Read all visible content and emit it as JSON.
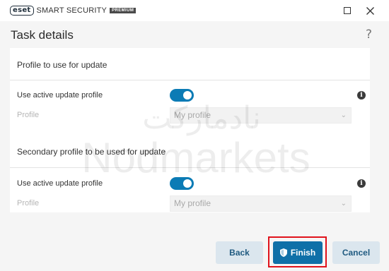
{
  "app": {
    "brand": "eset",
    "product": "SMART SECURITY",
    "edition": "PREMIUM"
  },
  "header": {
    "title": "Task details",
    "help": "?"
  },
  "sections": [
    {
      "title": "Profile to use for update",
      "toggle_label": "Use active update profile",
      "toggle_on": true,
      "profile_label": "Profile",
      "profile_value": "My profile"
    },
    {
      "title": "Secondary profile to be used for update",
      "toggle_label": "Use active update profile",
      "toggle_on": true,
      "profile_label": "Profile",
      "profile_value": "My profile"
    }
  ],
  "watermark": {
    "arabic": "نادمارکت",
    "latin": "Nodmarkets"
  },
  "buttons": {
    "back": "Back",
    "finish": "Finish",
    "cancel": "Cancel"
  },
  "colors": {
    "accent": "#0f70a8",
    "toggle": "#0b7bb5",
    "highlight": "#e0121b"
  }
}
